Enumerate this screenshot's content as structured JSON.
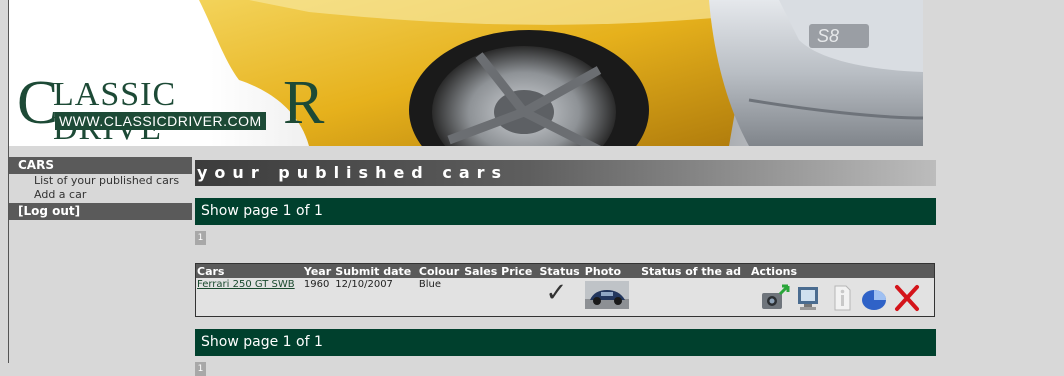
{
  "logo": {
    "big_c": "C",
    "word": "LASSIC DRIVE",
    "big_r": "R",
    "url": "WWW.CLASSICDRIVER.COM"
  },
  "banner_badge": "S8",
  "sidebar": {
    "section": "CARS",
    "items": [
      {
        "label": "List of your published cars"
      },
      {
        "label": "Add a car"
      }
    ],
    "logout": "[Log out]"
  },
  "main": {
    "title": "your published cars",
    "pager_text": "Show page 1 of 1",
    "page_number": "1",
    "columns": [
      "Cars",
      "Year",
      "Submit date",
      "Colour",
      "Sales Price",
      "Status",
      "Photo",
      "Status of the ad",
      "Actions"
    ],
    "rows": [
      {
        "car": "Ferrari 250 GT SWB",
        "year": "1960",
        "submit_date": "12/10/2007",
        "colour": "Blue",
        "sales_price": "",
        "status_icon": "check-icon",
        "status_of_ad": ""
      }
    ],
    "actions": [
      "upload-photo-icon",
      "preview-icon",
      "info-icon",
      "statistics-icon",
      "delete-icon"
    ]
  },
  "colors": {
    "dark_green": "#00402d",
    "logo_green": "#1d4a36",
    "sidebar_gray": "#5a5a5a",
    "yellow_car": "#e8b81e",
    "delete_red": "#d4141a"
  }
}
